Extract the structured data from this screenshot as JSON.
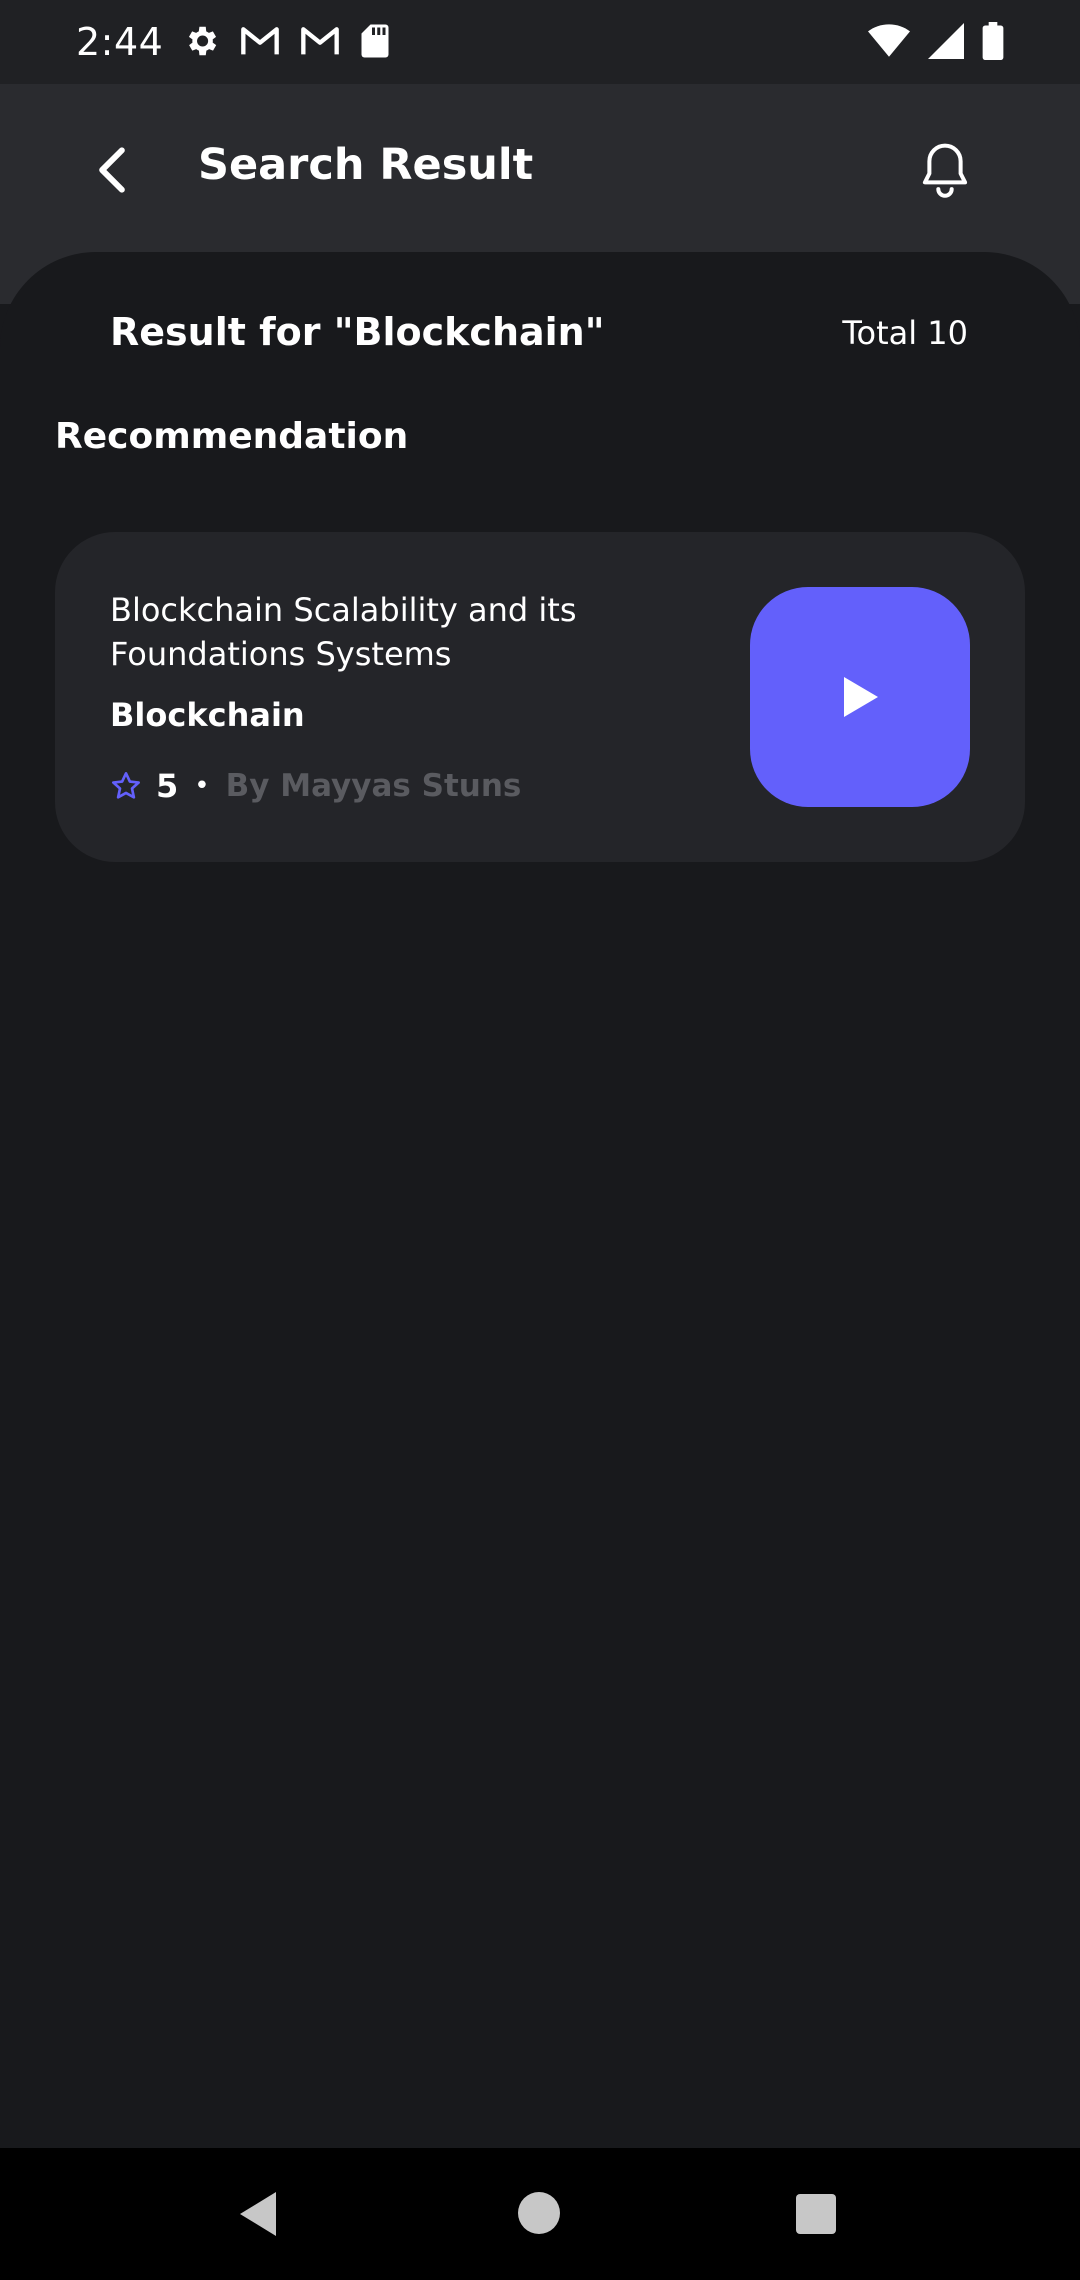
{
  "status_bar": {
    "time": "2:44",
    "left_icons": [
      "settings-icon",
      "gmail-icon",
      "gmail-icon",
      "sd-card-icon"
    ],
    "right_icons": [
      "wifi-icon",
      "signal-icon",
      "battery-icon"
    ]
  },
  "header": {
    "title": "Search Result",
    "back_icon": "chevron-left-icon",
    "bell_icon": "bell-icon"
  },
  "results": {
    "heading": "Result for \"Blockchain\"",
    "total": "Total 10"
  },
  "section": {
    "title": "Recommendation"
  },
  "course_card": {
    "title": "Blockchain Scalability and its Foundations Systems",
    "category": "Blockchain",
    "rating": "5",
    "separator": "•",
    "author": "By Mayyas Stuns",
    "play_icon": "play-icon"
  },
  "colors": {
    "accent": "#6360fb",
    "background": "#18191c",
    "header_bg": "#2a2b2f",
    "card_bg": "#242529",
    "muted_text": "#5a5b60"
  },
  "nav_bar": {
    "icons": [
      "nav-back-icon",
      "nav-home-icon",
      "nav-recents-icon"
    ]
  }
}
